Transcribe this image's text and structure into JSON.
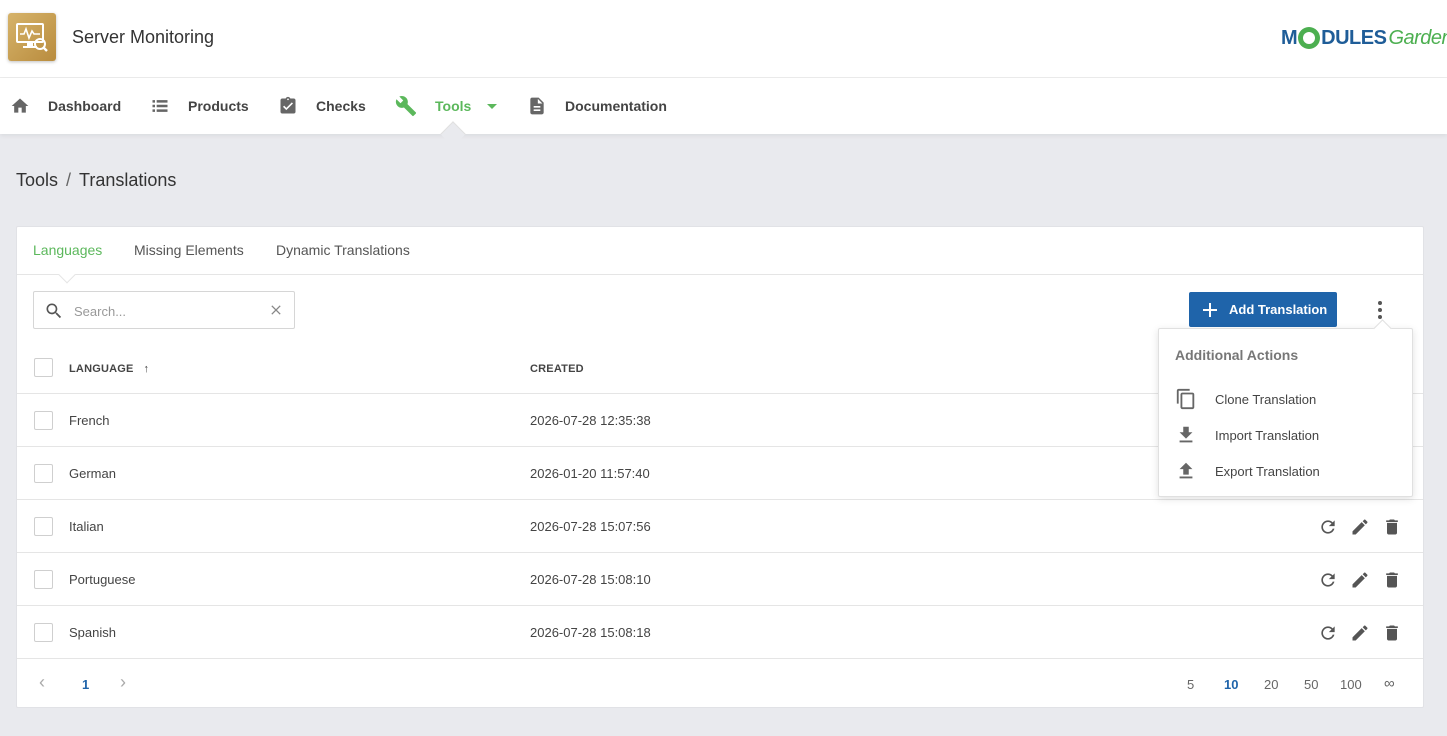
{
  "header": {
    "app_title": "Server Monitoring",
    "logo": {
      "part1": "M",
      "part2": "DULES",
      "part3": "Garden"
    },
    "colors": {
      "brand_green": "#5cb85c",
      "brand_blue": "#1f64aa"
    }
  },
  "nav": {
    "items": [
      {
        "label": "Dashboard",
        "icon": "home-icon"
      },
      {
        "label": "Products",
        "icon": "list-icon"
      },
      {
        "label": "Checks",
        "icon": "clipboard-check-icon"
      },
      {
        "label": "Tools",
        "icon": "wrench-icon",
        "active": true
      },
      {
        "label": "Documentation",
        "icon": "document-icon"
      }
    ]
  },
  "breadcrumb": {
    "parent": "Tools",
    "separator": "/",
    "current": "Translations"
  },
  "tabs": [
    {
      "label": "Languages",
      "active": true
    },
    {
      "label": "Missing Elements"
    },
    {
      "label": "Dynamic Translations"
    }
  ],
  "search": {
    "placeholder": "Search...",
    "value": ""
  },
  "toolbar": {
    "add_label": "Add Translation"
  },
  "table": {
    "columns": [
      {
        "label": "LANGUAGE",
        "sort": "asc"
      },
      {
        "label": "CREATED"
      }
    ],
    "rows": [
      {
        "language": "French",
        "created": "2026-07-28 12:35:38"
      },
      {
        "language": "German",
        "created": "2026-01-20 11:57:40"
      },
      {
        "language": "Italian",
        "created": "2026-07-28 15:07:56"
      },
      {
        "language": "Portuguese",
        "created": "2026-07-28 15:08:10"
      },
      {
        "language": "Spanish",
        "created": "2026-07-28 15:08:18"
      }
    ],
    "sort_arrow": "↑"
  },
  "pagination": {
    "prev": "‹",
    "current_page": "1",
    "next": "›",
    "page_sizes": [
      "5",
      "10",
      "20",
      "50",
      "100",
      "∞"
    ],
    "selected_size": "10"
  },
  "dropdown": {
    "title": "Additional Actions",
    "items": [
      {
        "label": "Clone Translation",
        "icon": "copy-icon"
      },
      {
        "label": "Import Translation",
        "icon": "download-icon"
      },
      {
        "label": "Export Translation",
        "icon": "upload-icon"
      }
    ]
  }
}
